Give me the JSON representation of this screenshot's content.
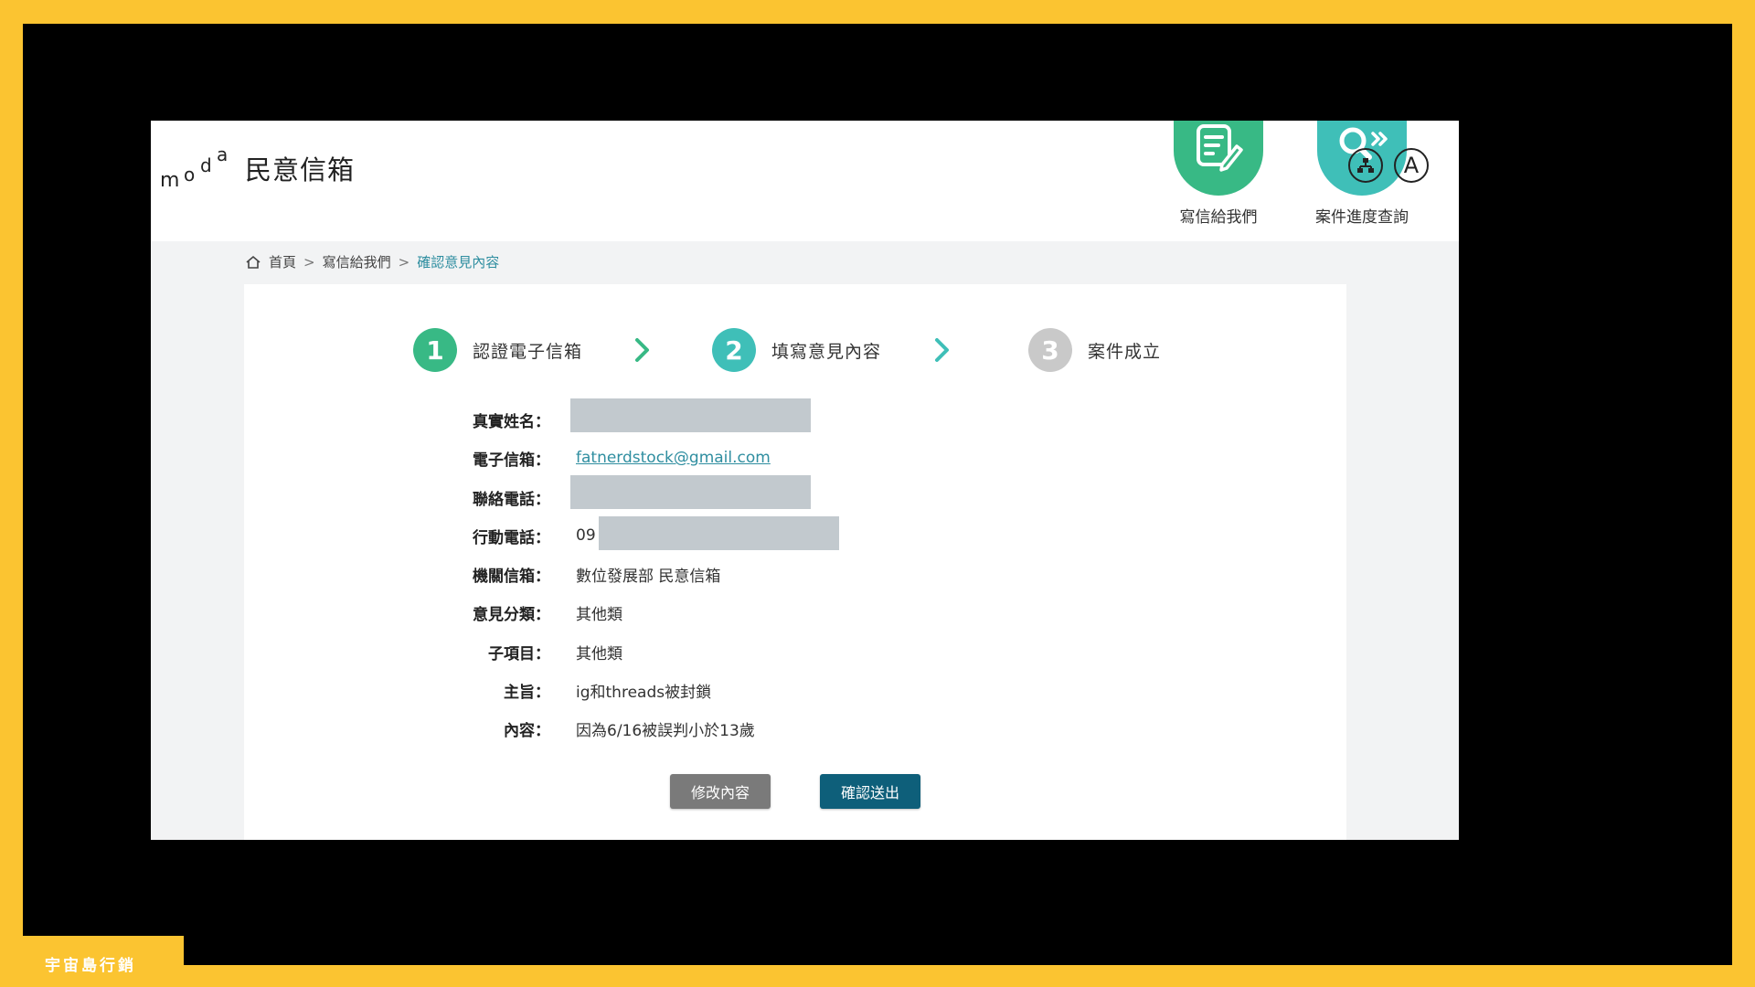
{
  "site": {
    "logo_text": "moda",
    "title": "民意信箱"
  },
  "nav": {
    "write_label": "寫信給我們",
    "track_label": "案件進度查詢",
    "write_icon": "edit-document-icon",
    "track_icon": "search-forward-icon",
    "font_size_label": "A",
    "sitemap_icon": "sitemap-icon"
  },
  "breadcrumb": {
    "home": "首頁",
    "separator": ">",
    "level1": "寫信給我們",
    "current": "確認意見內容"
  },
  "steps": [
    {
      "number": "1",
      "label": "認證電子信箱",
      "state": "done"
    },
    {
      "number": "2",
      "label": "填寫意見內容",
      "state": "current"
    },
    {
      "number": "3",
      "label": "案件成立",
      "state": "pending"
    }
  ],
  "form": {
    "name": {
      "label": "真實姓名：",
      "value": ""
    },
    "email": {
      "label": "電子信箱：",
      "value": "fatnerdstock@gmail.com"
    },
    "phone": {
      "label": "聯絡電話：",
      "value": ""
    },
    "mobile": {
      "label": "行動電話：",
      "value": "09"
    },
    "agency": {
      "label": "機關信箱：",
      "value": "數位發展部 民意信箱"
    },
    "category": {
      "label": "意見分類：",
      "value": "其他類"
    },
    "subcategory": {
      "label": "子項目：",
      "value": "其他類"
    },
    "subject": {
      "label": "主旨：",
      "value": "ig和threads被封鎖"
    },
    "content": {
      "label": "內容：",
      "value": "因為6/16被誤判小於13歲"
    }
  },
  "buttons": {
    "edit": "修改內容",
    "submit": "確認送出"
  },
  "watermark": "宇宙島行銷",
  "colors": {
    "frame": "#fbc431",
    "step_done": "#38b985",
    "step_current": "#3fbfb8",
    "step_pending": "#c9c9c9",
    "link": "#2f8ea0",
    "submit_button": "#0e5f7a",
    "edit_button": "#7a7a7a"
  }
}
